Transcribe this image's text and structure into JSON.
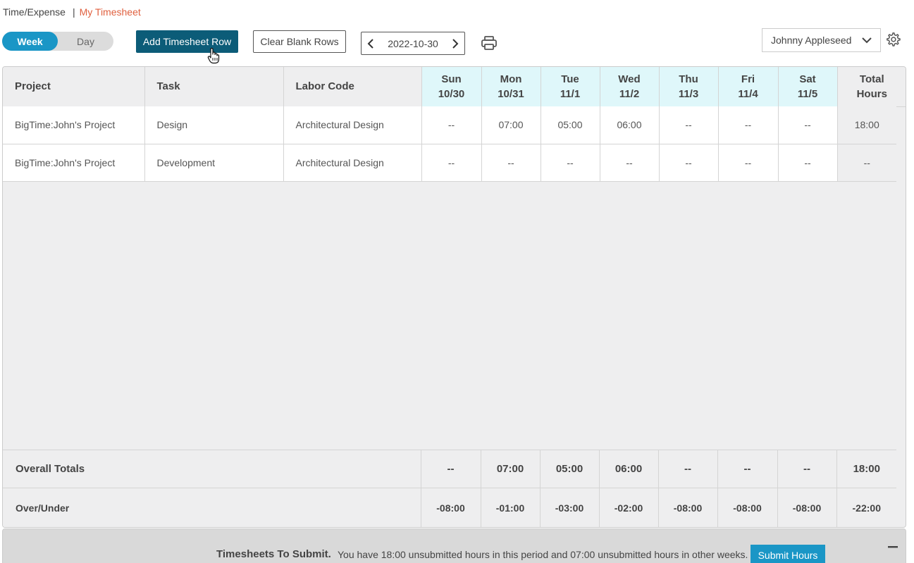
{
  "breadcrumb": {
    "parent": "Time/Expense",
    "separator": "|",
    "current": "My Timesheet"
  },
  "view_toggle": {
    "week": "Week",
    "day": "Day",
    "selected": "Week"
  },
  "toolbar": {
    "add_row_label": "Add Timesheet Row",
    "clear_rows_label": "Clear Blank Rows",
    "date": "2022-10-30"
  },
  "user_select": {
    "value": "Johnny Appleseed"
  },
  "columns": {
    "project": "Project",
    "task": "Task",
    "labor_code": "Labor Code",
    "days": [
      {
        "dow": "Sun",
        "date": "10/30"
      },
      {
        "dow": "Mon",
        "date": "10/31"
      },
      {
        "dow": "Tue",
        "date": "11/1"
      },
      {
        "dow": "Wed",
        "date": "11/2"
      },
      {
        "dow": "Thu",
        "date": "11/3"
      },
      {
        "dow": "Fri",
        "date": "11/4"
      },
      {
        "dow": "Sat",
        "date": "11/5"
      }
    ],
    "total_line1": "Total",
    "total_line2": "Hours"
  },
  "rows": [
    {
      "project": "BigTime:John's Project",
      "task": "Design",
      "labor_code": "Architectural Design",
      "hours": [
        "--",
        "07:00",
        "05:00",
        "06:00",
        "--",
        "--",
        "--"
      ],
      "total": "18:00"
    },
    {
      "project": "BigTime:John's Project",
      "task": "Development",
      "labor_code": "Architectural Design",
      "hours": [
        "--",
        "--",
        "--",
        "--",
        "--",
        "--",
        "--"
      ],
      "total": "--"
    }
  ],
  "overall_totals": {
    "label": "Overall Totals",
    "values": [
      "--",
      "07:00",
      "05:00",
      "06:00",
      "--",
      "--",
      "--"
    ],
    "total": "18:00"
  },
  "over_under": {
    "label": "Over/Under",
    "values": [
      "-08:00",
      "-01:00",
      "-03:00",
      "-02:00",
      "-08:00",
      "-08:00",
      "-08:00"
    ],
    "total": "-22:00"
  },
  "submit_bar": {
    "title": "Timesheets To Submit.",
    "message": "You have 18:00 unsubmitted hours in this period and 07:00 unsubmitted hours in other weeks.",
    "button": "Submit Hours"
  },
  "colors": {
    "primary_dark": "#0c5c78",
    "accent_blue": "#1a96c6",
    "breadcrumb_current": "#e0603f",
    "day_header_bg": "#dff7fa",
    "grid_bg": "#eeeeef"
  }
}
